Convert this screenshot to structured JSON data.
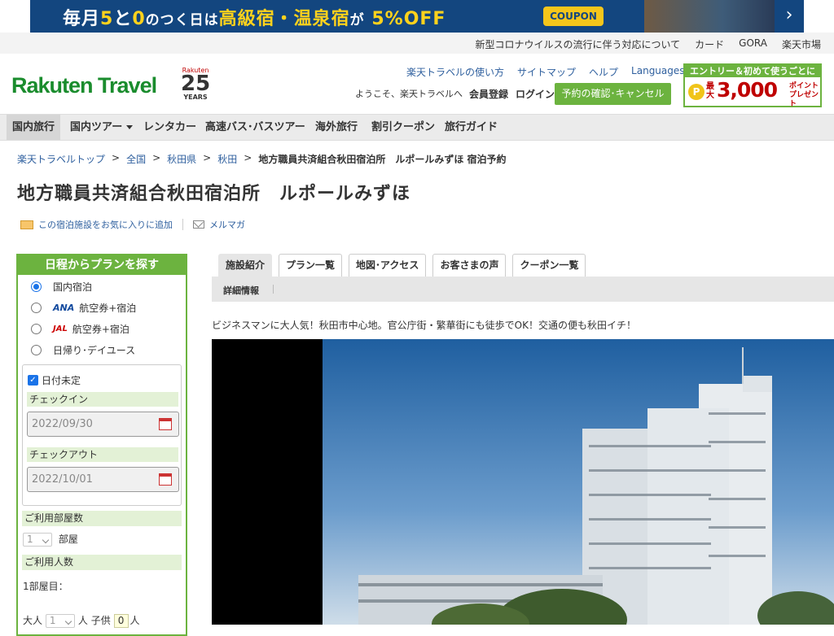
{
  "banner": {
    "prefix": "毎月",
    "n1": "5",
    "mid1": "と",
    "n2": "0",
    "mid2": "のつく日は",
    "hl": "高級宿・温泉宿",
    "mid3": "が",
    "pct": "5%OFF",
    "coupon": "COUPON",
    "next_icon": "chevron-right-icon"
  },
  "utilbar": {
    "links": [
      "新型コロナウイルスの流行に伴う対応について",
      "カード",
      "GORA",
      "楽天市場"
    ]
  },
  "header": {
    "logo_text": "Rakuten Travel",
    "years_brand": "Rakuten",
    "years_number": "25",
    "years_word": "YEARS",
    "links": [
      "楽天トラベルの使い方",
      "サイトマップ",
      "ヘルプ"
    ],
    "languages": "Languages",
    "welcome": "ようこそ、楽天トラベルへ",
    "member": "会員登録",
    "login": "ログイン",
    "reserve_btn": "予約の確認･キャンセル",
    "promo_top": "エントリー＆初めて使うごとに",
    "promo_max": "最大",
    "promo_amount": "3,000",
    "promo_point": "ポイントプレゼント",
    "promo_coin": "P"
  },
  "gnav": [
    "国内旅行",
    "国内ツアー",
    "レンタカー",
    "高速バス･バスツアー",
    "海外旅行",
    "割引クーポン",
    "旅行ガイド"
  ],
  "breadcrumb": [
    "楽天トラベルトップ",
    "全国",
    "秋田県",
    "秋田",
    "地方職員共済組合秋田宿泊所　ルポールみずほ 宿泊予約"
  ],
  "breadcrumb_sep": ">",
  "title": "地方職員共済組合秋田宿泊所　ルポールみずほ",
  "fav_link": "この宿泊施設をお気に入りに追加",
  "mailmag": "メルマガ",
  "sidebar": {
    "heading": "日程からプランを探す",
    "options": [
      "国内宿泊",
      "航空券+宿泊",
      "航空券+宿泊",
      "日帰り･デイユース"
    ],
    "ana": "ANA",
    "jal": "JAL",
    "undecided": "日付未定",
    "checkin_label": "チェックイン",
    "checkin_value": "2022/09/30",
    "checkout_label": "チェックアウト",
    "checkout_value": "2022/10/01",
    "rooms_label": "ご利用部屋数",
    "rooms_value": "1",
    "rooms_unit": "部屋",
    "people_label": "ご利用人数",
    "room1": "1部屋目：",
    "adult": "大人",
    "adult_value": "1",
    "person_unit": "人",
    "child": "子供",
    "child_value": "0",
    "person_unit2": "人"
  },
  "tabs": [
    "施設紹介",
    "プラン一覧",
    "地図･アクセス",
    "お客さまの声",
    "クーポン一覧"
  ],
  "subtab": "詳細情報",
  "catch": "ビジネスマンに大人気！秋田市中心地。官公庁街・繁華街にも徒歩でOK！交通の便も秋田イチ！",
  "colors": {
    "accent": "#6cb33f",
    "banner": "#13467f",
    "link": "#2e5f9e",
    "logo": "#1a8c2d"
  }
}
